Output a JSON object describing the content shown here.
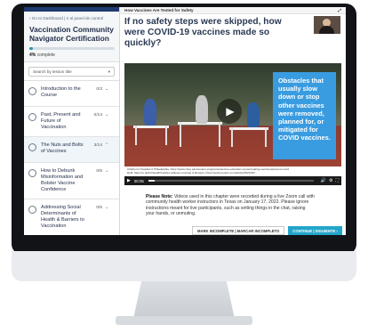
{
  "sidebar": {
    "back_link": "‹ Go to Dashboard | Ir al panel de control",
    "course_title": "Vaccination Community Navigator Certification",
    "progress_percent": 4,
    "progress_value": "4%",
    "progress_suffix": "complete",
    "search_placeholder": "Search by lesson title",
    "lessons": [
      {
        "title": "Introduction to the Course",
        "count": "0/3"
      },
      {
        "title": "Past, Present and Future of Vaccination",
        "count": "0/14"
      },
      {
        "title": "The Nuts and Bolts of Vaccines",
        "count": "3/14"
      },
      {
        "title": "How to Debunk Misinformation and Bolster Vaccine Confidence",
        "count": "0/6"
      },
      {
        "title": "Addressing Social Determinants of Health & Barriers to Vaccination",
        "count": "0/6"
      }
    ]
  },
  "main": {
    "topbar_title": "How Vaccines Are Tested for Safety",
    "heading": "If no safety steps were skipped, how were COVID-19 vaccines made so quickly?",
    "video": {
      "callout": "Obstacles that usually slow down or stop other vaccines were removed, planned for, or mitigated for COVID vaccines.",
      "caption_line1": "Children's Hospital of Philadelphia. https://www.chop.edu/centers-programs/vaccine-education-center/making-vaccines/prevent-covid",
      "caption_line2": "Delfi, https://e.delfi.lt/health/hurdles-athletes-running/ & Reuters, https://www.reuters.com/article/2021/09/...",
      "time": "00:05",
      "progress_fraction": 0.04
    },
    "note_label": "Please Note:",
    "note_text": " Videos used in this chapter were recorded during a live Zoom call with community health worker instructors in Texas on January 17, 2022. Please ignore instructions meant for live participants, such as writing things in the chat, raising your hands, or unmuting.",
    "mark_incomplete_label": "MARK INCOMPLETE | MARCAR INCOMPLETO",
    "continue_label": "CONTINUE | SIGUIENTE ›"
  },
  "colors": {
    "accent": "#23a5c9",
    "callout": "#3a9ce0",
    "title_text": "#2b3a55",
    "progress": "#2a93b8"
  }
}
